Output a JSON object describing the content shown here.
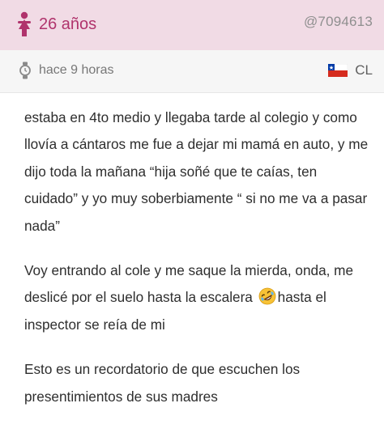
{
  "header": {
    "age_label": "26 años",
    "user_id": "@7094613",
    "age_icon": "female-person-icon",
    "background_color": "#f1dbe5",
    "accent_color": "#b0336c"
  },
  "meta": {
    "time_label": "hace 9 horas",
    "time_icon": "watch-icon",
    "country_code": "CL",
    "country_icon": "chile-flag-icon"
  },
  "post": {
    "paragraph_1": "estaba en 4to medio y llegaba tarde al colegio y como llovía a cántaros me fue a dejar mi mamá en auto, y me dijo toda la mañana “hija soñé que te caías, ten cuidado” y yo muy soberbiamente “ si no me va a pasar nada”",
    "paragraph_2_part_1": "Voy entrando al cole y me saque la mierda, onda, me deslicé por el suelo hasta la escalera",
    "paragraph_2_emoji": "rolling-on-floor-laughing-emoji",
    "paragraph_2_part_2": "hasta el inspector se reía de mi",
    "paragraph_3": "Esto es un recordatorio de que escuchen los presentimientos de sus madres"
  }
}
